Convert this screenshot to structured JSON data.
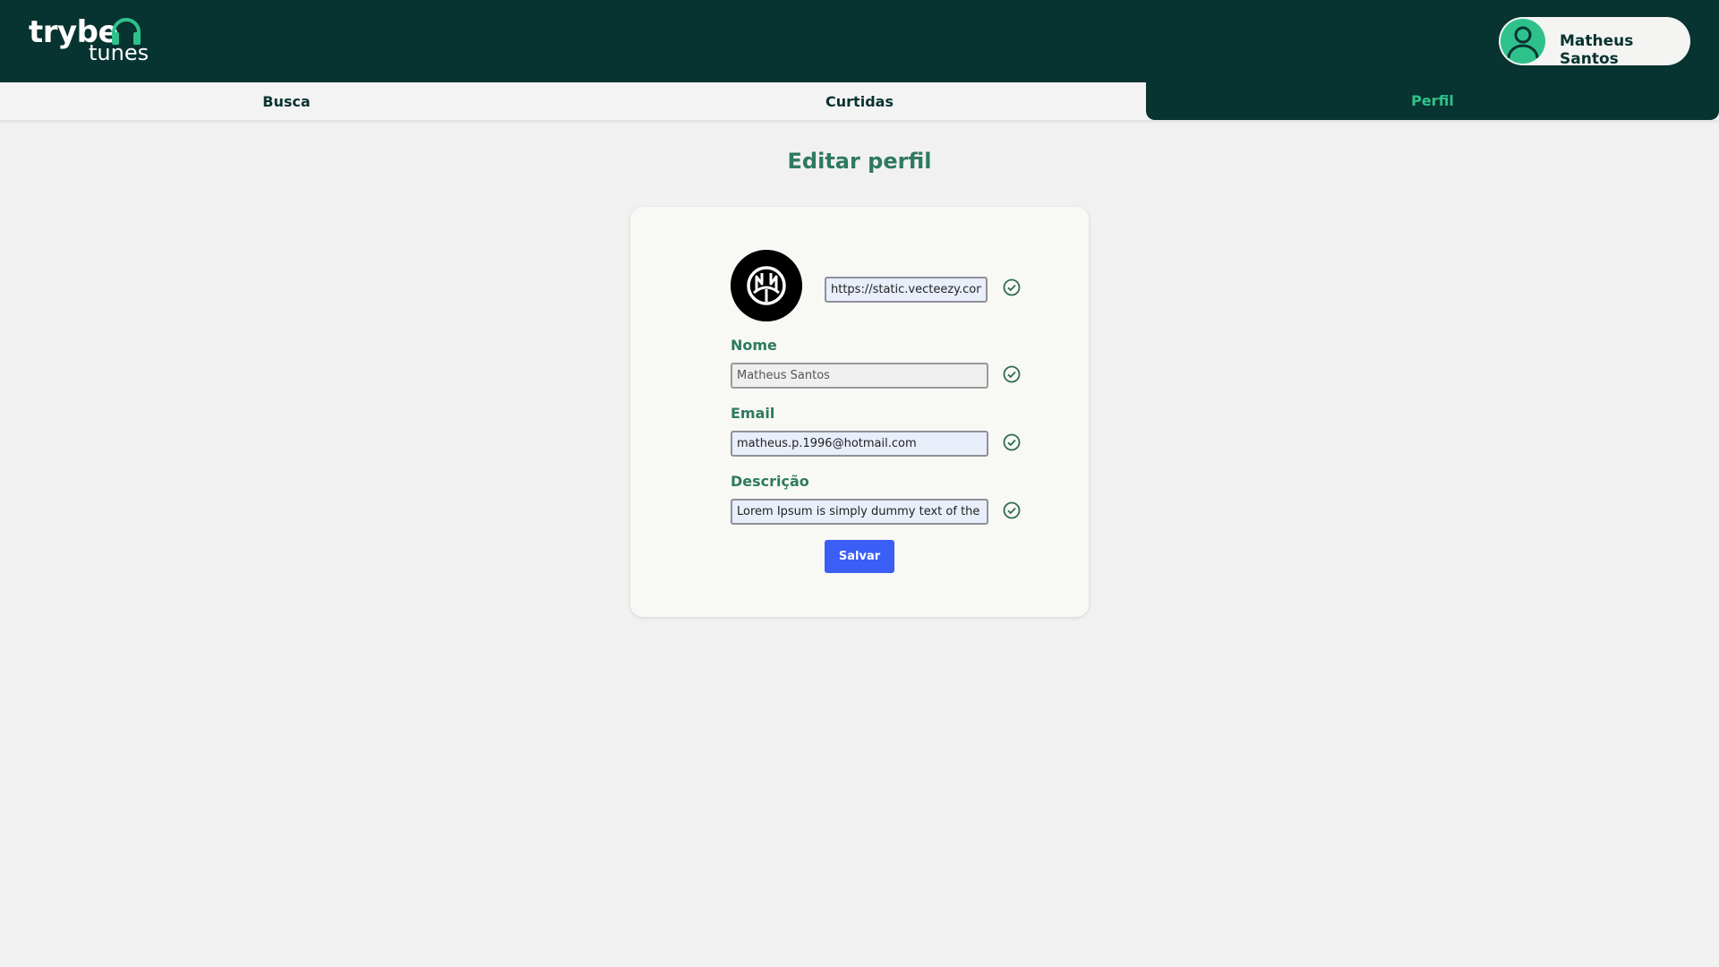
{
  "header": {
    "logo_word": "trybe",
    "logo_sub": "tunes",
    "user_name": "Matheus Santos"
  },
  "nav": {
    "tabs": [
      {
        "label": "Busca",
        "active": false
      },
      {
        "label": "Curtidas",
        "active": false
      },
      {
        "label": "Perfil",
        "active": true
      }
    ]
  },
  "page": {
    "title": "Editar perfil"
  },
  "form": {
    "image_url": "https://static.vecteezy.com/",
    "name_label": "Nome",
    "name_value": "Matheus Santos",
    "email_label": "Email",
    "email_value": "matheus.p.1996@hotmail.com",
    "description_label": "Descrição",
    "description_value": "Lorem Ipsum is simply dummy text of the pr",
    "save_label": "Salvar"
  },
  "colors": {
    "header_bg": "#073330",
    "accent_green": "#2fc18c",
    "label_green": "#2e7a60",
    "button_blue": "#3a5ef6"
  },
  "icons": {
    "logo": "headphones-icon",
    "user": "user-avatar-icon",
    "valid": "check-circle-icon"
  }
}
